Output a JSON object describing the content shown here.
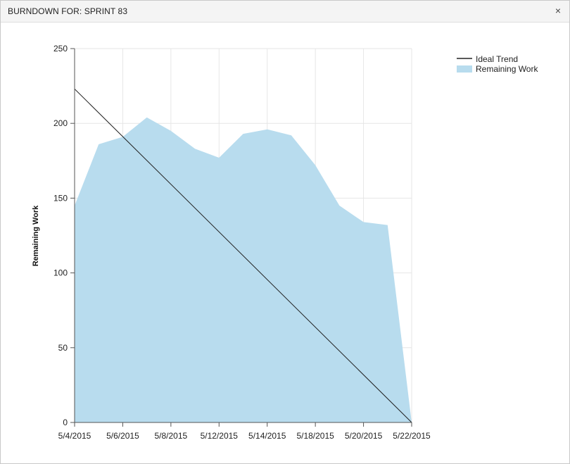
{
  "dialog": {
    "title": "BURNDOWN FOR: SPRINT 83",
    "close_glyph": "×"
  },
  "colors": {
    "remaining_fill": "#b8dcee",
    "ideal_line": "#222222",
    "grid": "#e6e6e6"
  },
  "chart_data": {
    "type": "area",
    "title": "",
    "xlabel": "",
    "ylabel": "Remaining Work",
    "x_tick_labels": [
      "5/4/2015",
      "5/6/2015",
      "5/8/2015",
      "5/12/2015",
      "5/14/2015",
      "5/18/2015",
      "5/20/2015",
      "5/22/2015"
    ],
    "y_tick_labels": [
      "0",
      "50",
      "100",
      "150",
      "200",
      "250"
    ],
    "ylim": [
      0,
      250
    ],
    "grid": true,
    "legend_position": "top-right",
    "series": [
      {
        "name": "Remaining Work",
        "type": "area",
        "values": [
          145,
          186,
          191,
          204,
          195,
          183,
          177,
          193,
          196,
          192,
          172,
          145,
          134,
          132,
          0
        ]
      },
      {
        "name": "Ideal Trend",
        "type": "line",
        "values": [
          223,
          0
        ]
      }
    ]
  }
}
